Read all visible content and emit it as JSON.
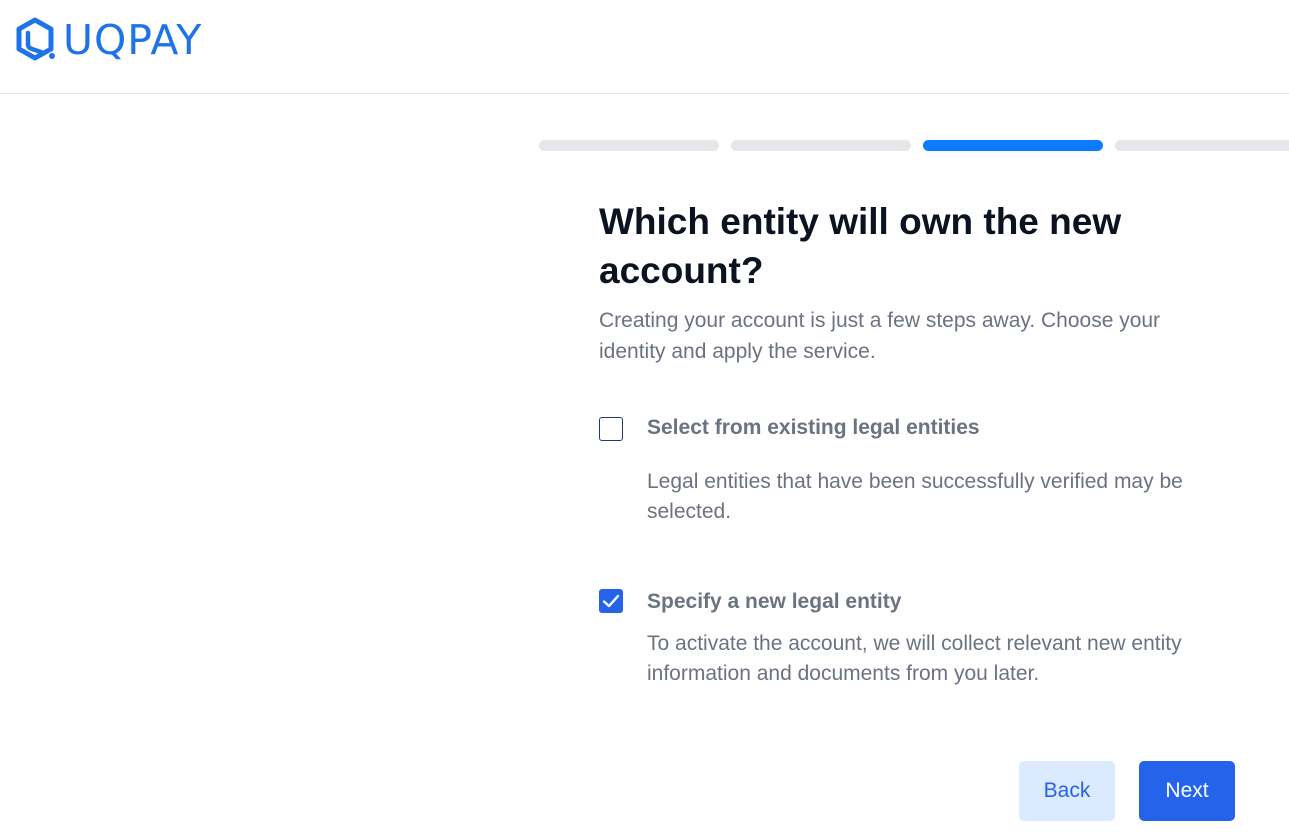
{
  "brand": {
    "name": "UQPAY",
    "color": "#1e73e8",
    "icon": "uqpay-logo-icon"
  },
  "progress": {
    "total_steps": 4,
    "current_step": 3,
    "active_color": "#0a7cff"
  },
  "main": {
    "title": "Which entity will own the new account?",
    "subtitle": "Creating your account is just a few steps away. Choose your identity and apply the service."
  },
  "options": [
    {
      "title": "Select from existing legal entities",
      "description": "Legal entities that have been successfully verified may be selected.",
      "checked": false
    },
    {
      "title": "Specify a new legal entity",
      "description": "To activate the account, we will collect relevant new entity information and documents from you later.",
      "checked": true
    }
  ],
  "actions": {
    "back_label": "Back",
    "next_label": "Next",
    "primary_color": "#2563eb"
  }
}
